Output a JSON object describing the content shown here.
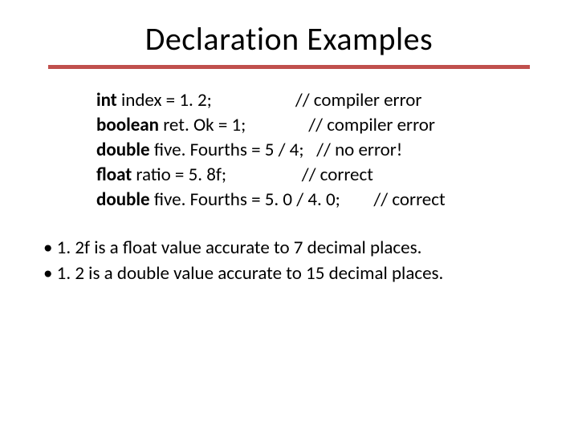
{
  "title": "Declaration Examples",
  "code": [
    {
      "kw": "int",
      "rest": " index = 1. 2;",
      "pad": "                    ",
      "comment": "// compiler error"
    },
    {
      "kw": "boolean",
      "rest": " ret. Ok = 1;",
      "pad": "               ",
      "comment": "// compiler error"
    },
    {
      "kw": "double",
      "rest": " five. Fourths = 5 / 4;",
      "pad": "   ",
      "comment": "// no error!"
    },
    {
      "kw": "float",
      "rest": " ratio = 5. 8f;",
      "pad": "                  ",
      "comment": "// correct"
    },
    {
      "kw": "double",
      "rest": " five. Fourths = 5. 0 / 4. 0;",
      "pad": "        ",
      "comment": "// correct"
    }
  ],
  "bullets": [
    "1. 2f is a float value accurate to 7 decimal places.",
    "1. 2 is a double value accurate to 15 decimal places."
  ]
}
